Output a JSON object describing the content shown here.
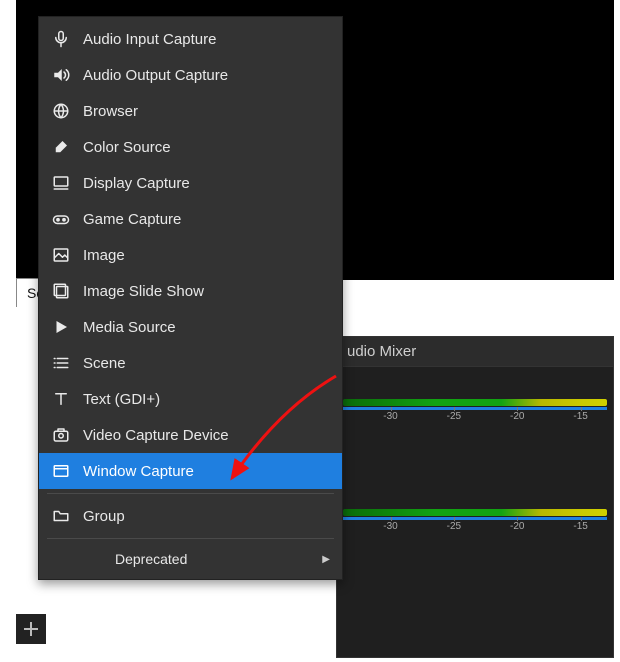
{
  "preview": {},
  "tabs": {
    "sources_label": "So"
  },
  "mixer": {
    "title": "udio Mixer",
    "ticks": [
      "-30",
      "-25",
      "-20",
      "-15"
    ]
  },
  "menu": {
    "items": [
      {
        "icon": "mic-icon",
        "label": "Audio Input Capture"
      },
      {
        "icon": "speaker-icon",
        "label": "Audio Output Capture"
      },
      {
        "icon": "globe-icon",
        "label": "Browser"
      },
      {
        "icon": "brush-icon",
        "label": "Color Source"
      },
      {
        "icon": "monitor-icon",
        "label": "Display Capture"
      },
      {
        "icon": "gamepad-icon",
        "label": "Game Capture"
      },
      {
        "icon": "image-icon",
        "label": "Image"
      },
      {
        "icon": "slideshow-icon",
        "label": "Image Slide Show"
      },
      {
        "icon": "play-icon",
        "label": "Media Source"
      },
      {
        "icon": "list-icon",
        "label": "Scene"
      },
      {
        "icon": "text-icon",
        "label": "Text (GDI+)"
      },
      {
        "icon": "camera-icon",
        "label": "Video Capture Device"
      },
      {
        "icon": "window-icon",
        "label": "Window Capture",
        "highlight": true
      },
      {
        "sep": true
      },
      {
        "icon": "folder-icon",
        "label": "Group"
      },
      {
        "sep": true
      },
      {
        "icon": "",
        "label": "Deprecated",
        "submenu": true
      }
    ]
  },
  "annotations": {
    "arrow_color": "#e11"
  }
}
